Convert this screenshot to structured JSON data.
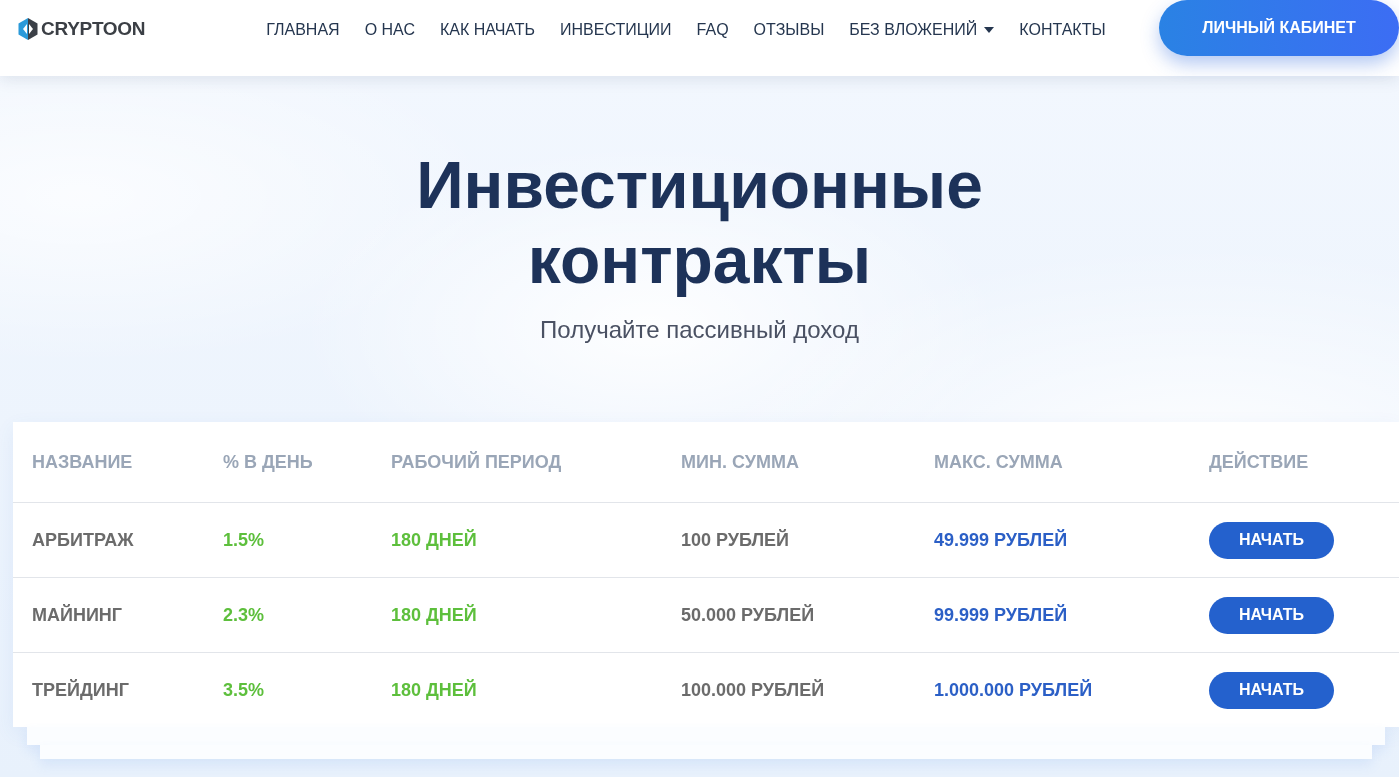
{
  "header": {
    "logo": {
      "text": "CRYPTOON"
    },
    "nav": [
      {
        "label": "ГЛАВНАЯ",
        "kind": "link"
      },
      {
        "label": "О НАС",
        "kind": "link"
      },
      {
        "label": "КАК НАЧАТЬ",
        "kind": "link"
      },
      {
        "label": "ИНВЕСТИЦИИ",
        "kind": "link"
      },
      {
        "label": "FAQ",
        "kind": "link"
      },
      {
        "label": "ОТЗЫВЫ",
        "kind": "link"
      },
      {
        "label": "БЕЗ ВЛОЖЕНИЙ",
        "kind": "dropdown"
      },
      {
        "label": "КОНТАКТЫ",
        "kind": "link"
      }
    ],
    "account_button": "ЛИЧНЫЙ КАБИНЕТ"
  },
  "hero": {
    "title": "Инвестиционные контракты",
    "subtitle": "Получайте пассивный доход"
  },
  "table": {
    "columns": [
      "НАЗВАНИЕ",
      "% В ДЕНЬ",
      "РАБОЧИЙ ПЕРИОД",
      "МИН. СУММА",
      "МАКС. СУММА",
      "ДЕЙСТВИЕ"
    ],
    "rows": [
      {
        "cells": [
          "АРБИТРАЖ",
          "1.5%",
          "180 ДНЕЙ",
          "100 РУБЛЕЙ",
          "49.999 РУБЛЕЙ"
        ],
        "action": "НАЧАТЬ"
      },
      {
        "cells": [
          "МАЙНИНГ",
          "2.3%",
          "180 ДНЕЙ",
          "50.000 РУБЛЕЙ",
          "99.999 РУБЛЕЙ"
        ],
        "action": "НАЧАТЬ"
      },
      {
        "cells": [
          "ТРЕЙДИНГ",
          "3.5%",
          "180 ДНЕЙ",
          "100.000 РУБЛЕЙ",
          "1.000.000 РУБЛЕЙ"
        ],
        "action": "НАЧАТЬ"
      }
    ]
  }
}
